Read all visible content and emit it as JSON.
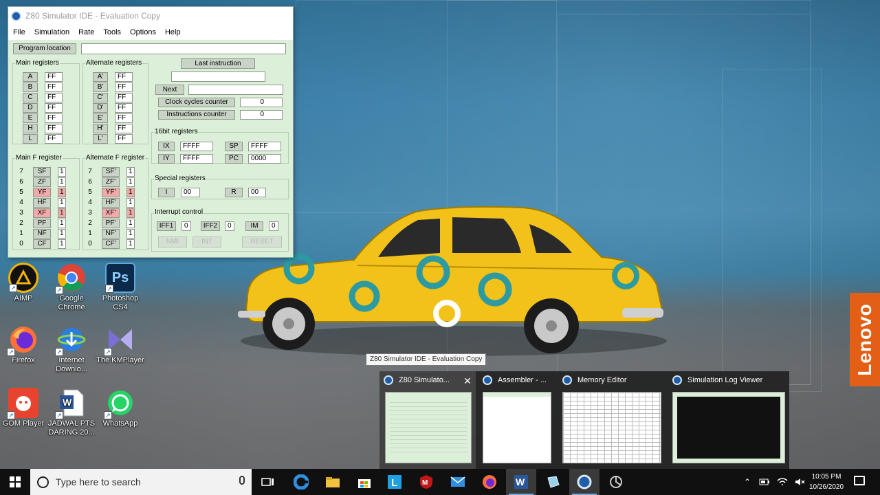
{
  "simulator": {
    "title": "Z80 Simulator IDE - Evaluation Copy",
    "menu": [
      "File",
      "Simulation",
      "Rate",
      "Tools",
      "Options",
      "Help"
    ],
    "program_location_label": "Program location",
    "main_registers_label": "Main registers",
    "alternate_registers_label": "Alternate registers",
    "main_registers": [
      {
        "name": "A",
        "value": "FF"
      },
      {
        "name": "B",
        "value": "FF"
      },
      {
        "name": "C",
        "value": "FF"
      },
      {
        "name": "D",
        "value": "FF"
      },
      {
        "name": "E",
        "value": "FF"
      },
      {
        "name": "H",
        "value": "FF"
      },
      {
        "name": "L",
        "value": "FF"
      }
    ],
    "alternate_registers": [
      {
        "name": "A'",
        "value": "FF"
      },
      {
        "name": "B'",
        "value": "FF"
      },
      {
        "name": "C'",
        "value": "FF"
      },
      {
        "name": "D'",
        "value": "FF"
      },
      {
        "name": "E'",
        "value": "FF"
      },
      {
        "name": "H'",
        "value": "FF"
      },
      {
        "name": "L'",
        "value": "FF"
      }
    ],
    "last_instruction_label": "Last instruction",
    "next_label": "Next",
    "clock_cycles_label": "Clock cycles counter",
    "clock_cycles_value": "0",
    "instructions_label": "Instructions counter",
    "instructions_value": "0",
    "main_f_label": "Main F register",
    "alternate_f_label": "Alternate F register",
    "main_flags": [
      {
        "bit": "7",
        "name": "SF",
        "value": "1"
      },
      {
        "bit": "6",
        "name": "ZF",
        "value": "1"
      },
      {
        "bit": "5",
        "name": "YF",
        "value": "1"
      },
      {
        "bit": "4",
        "name": "HF",
        "value": "1"
      },
      {
        "bit": "3",
        "name": "XF",
        "value": "1"
      },
      {
        "bit": "2",
        "name": "PF",
        "value": "1"
      },
      {
        "bit": "1",
        "name": "NF",
        "value": "1"
      },
      {
        "bit": "0",
        "name": "CF",
        "value": "1"
      }
    ],
    "alternate_flags": [
      {
        "bit": "7",
        "name": "SF'",
        "value": "1"
      },
      {
        "bit": "6",
        "name": "ZF'",
        "value": "1"
      },
      {
        "bit": "5",
        "name": "YF'",
        "value": "1"
      },
      {
        "bit": "4",
        "name": "HF'",
        "value": "1"
      },
      {
        "bit": "3",
        "name": "XF'",
        "value": "1"
      },
      {
        "bit": "2",
        "name": "PF'",
        "value": "1"
      },
      {
        "bit": "1",
        "name": "NF'",
        "value": "1"
      },
      {
        "bit": "0",
        "name": "CF'",
        "value": "1"
      }
    ],
    "sixteen_bit_label": "16bit registers",
    "ix": {
      "name": "IX",
      "value": "FFFF"
    },
    "iy": {
      "name": "IY",
      "value": "FFFF"
    },
    "sp": {
      "name": "SP",
      "value": "FFFF"
    },
    "pc": {
      "name": "PC",
      "value": "0000"
    },
    "special_label": "Special registers",
    "i": {
      "name": "I",
      "value": "00"
    },
    "r": {
      "name": "R",
      "value": "00"
    },
    "interrupt_label": "Interrupt control",
    "iff1": {
      "name": "IFF1",
      "value": "0"
    },
    "iff2": {
      "name": "IFF2",
      "value": "0"
    },
    "im": {
      "name": "IM",
      "value": "0"
    },
    "nmi_label": "NMI",
    "int_label": "INT",
    "reset_label": "RESET"
  },
  "desktop_icons": [
    {
      "label": "AIMP",
      "icon": "aimp-icon"
    },
    {
      "label": "Google Chrome",
      "icon": "chrome-icon"
    },
    {
      "label": "Photoshop CS4",
      "icon": "photoshop-icon"
    },
    {
      "label": "Firefox",
      "icon": "firefox-icon"
    },
    {
      "label": "Internet Downlo...",
      "icon": "idm-icon"
    },
    {
      "label": "The KMPlayer",
      "icon": "kmplayer-icon"
    },
    {
      "label": "GOM Player",
      "icon": "gom-player-icon"
    },
    {
      "label": "JADWAL PTS DARING 20...",
      "icon": "word-doc-icon"
    },
    {
      "label": "WhatsApp",
      "icon": "whatsapp-icon"
    }
  ],
  "lenovo_badge": "Lenovo",
  "tooltip": "Z80 Simulator IDE - Evaluation Copy",
  "thumbnails": [
    {
      "title": "Z80 Simulato...",
      "close": "✕"
    },
    {
      "title": "Assembler - ..."
    },
    {
      "title": "Memory Editor"
    },
    {
      "title": "Simulation Log Viewer"
    }
  ],
  "taskbar": {
    "search_placeholder": "Type here to search",
    "apps": [
      "task-view-icon",
      "edge-icon",
      "file-explorer-icon",
      "store-icon",
      "l-app-icon",
      "mcafee-icon",
      "mail-icon",
      "firefox-icon",
      "word-icon",
      "3d-app-icon",
      "z80-simulator-icon",
      "settings-icon"
    ],
    "time": "10:05 PM",
    "date": "10/26/2020"
  },
  "colors": {
    "sim_bg": "#dcefd8",
    "flag_highlight": "#f1a9a9",
    "lenovo": "#e35f16",
    "taskbar": "#101010"
  }
}
